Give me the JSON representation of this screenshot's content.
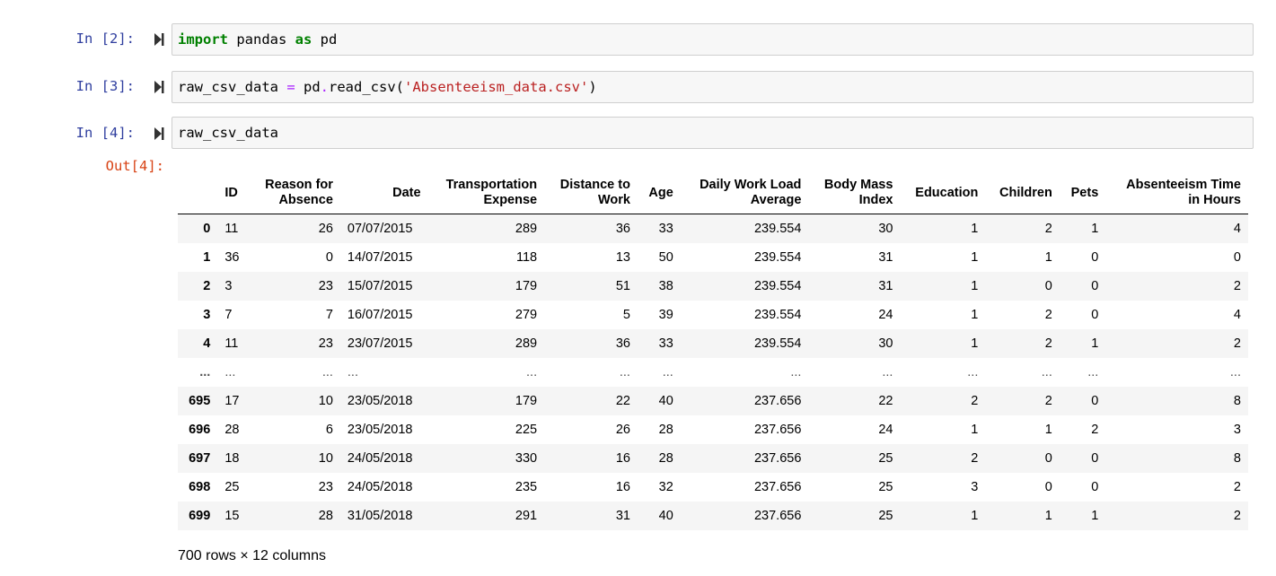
{
  "cells": [
    {
      "prompt": "In [2]:",
      "code_parts": [
        {
          "text": "import",
          "cls": "kw"
        },
        {
          "text": " pandas ",
          "cls": ""
        },
        {
          "text": "as",
          "cls": "kw"
        },
        {
          "text": " pd",
          "cls": ""
        }
      ]
    },
    {
      "prompt": "In [3]:",
      "code_parts": [
        {
          "text": "raw_csv_data ",
          "cls": ""
        },
        {
          "text": "=",
          "cls": "op"
        },
        {
          "text": " pd",
          "cls": ""
        },
        {
          "text": ".",
          "cls": "op"
        },
        {
          "text": "read_csv(",
          "cls": ""
        },
        {
          "text": "'Absenteeism_data.csv'",
          "cls": "str"
        },
        {
          "text": ")",
          "cls": ""
        }
      ]
    },
    {
      "prompt": "In [4]:",
      "code_parts": [
        {
          "text": "raw_csv_data",
          "cls": ""
        }
      ]
    }
  ],
  "output": {
    "prompt": "Out[4]:",
    "columns": [
      "ID",
      "Reason for\nAbsence",
      "Date",
      "Transportation\nExpense",
      "Distance to\nWork",
      "Age",
      "Daily Work Load\nAverage",
      "Body Mass\nIndex",
      "Education",
      "Children",
      "Pets",
      "Absenteeism Time\nin Hours"
    ],
    "rows": [
      {
        "index": "0",
        "values": [
          "11",
          "26",
          "07/07/2015",
          "289",
          "36",
          "33",
          "239.554",
          "30",
          "1",
          "2",
          "1",
          "4"
        ]
      },
      {
        "index": "1",
        "values": [
          "36",
          "0",
          "14/07/2015",
          "118",
          "13",
          "50",
          "239.554",
          "31",
          "1",
          "1",
          "0",
          "0"
        ]
      },
      {
        "index": "2",
        "values": [
          "3",
          "23",
          "15/07/2015",
          "179",
          "51",
          "38",
          "239.554",
          "31",
          "1",
          "0",
          "0",
          "2"
        ]
      },
      {
        "index": "3",
        "values": [
          "7",
          "7",
          "16/07/2015",
          "279",
          "5",
          "39",
          "239.554",
          "24",
          "1",
          "2",
          "0",
          "4"
        ]
      },
      {
        "index": "4",
        "values": [
          "11",
          "23",
          "23/07/2015",
          "289",
          "36",
          "33",
          "239.554",
          "30",
          "1",
          "2",
          "1",
          "2"
        ]
      },
      {
        "index": "...",
        "values": [
          "...",
          "...",
          "...",
          "...",
          "...",
          "...",
          "...",
          "...",
          "...",
          "...",
          "...",
          "..."
        ]
      },
      {
        "index": "695",
        "values": [
          "17",
          "10",
          "23/05/2018",
          "179",
          "22",
          "40",
          "237.656",
          "22",
          "2",
          "2",
          "0",
          "8"
        ]
      },
      {
        "index": "696",
        "values": [
          "28",
          "6",
          "23/05/2018",
          "225",
          "26",
          "28",
          "237.656",
          "24",
          "1",
          "1",
          "2",
          "3"
        ]
      },
      {
        "index": "697",
        "values": [
          "18",
          "10",
          "24/05/2018",
          "330",
          "16",
          "28",
          "237.656",
          "25",
          "2",
          "0",
          "0",
          "8"
        ]
      },
      {
        "index": "698",
        "values": [
          "25",
          "23",
          "24/05/2018",
          "235",
          "16",
          "32",
          "237.656",
          "25",
          "3",
          "0",
          "0",
          "2"
        ]
      },
      {
        "index": "699",
        "values": [
          "15",
          "28",
          "31/05/2018",
          "291",
          "31",
          "40",
          "237.656",
          "25",
          "1",
          "1",
          "1",
          "2"
        ]
      }
    ],
    "shape_note": "700 rows × 12 columns"
  },
  "icons": {
    "run": "run-cell-icon"
  },
  "colors": {
    "in_prompt": "#303f9f",
    "out_prompt": "#d84315",
    "keyword": "#008000",
    "operator": "#aa22ff",
    "string": "#ba2121"
  }
}
